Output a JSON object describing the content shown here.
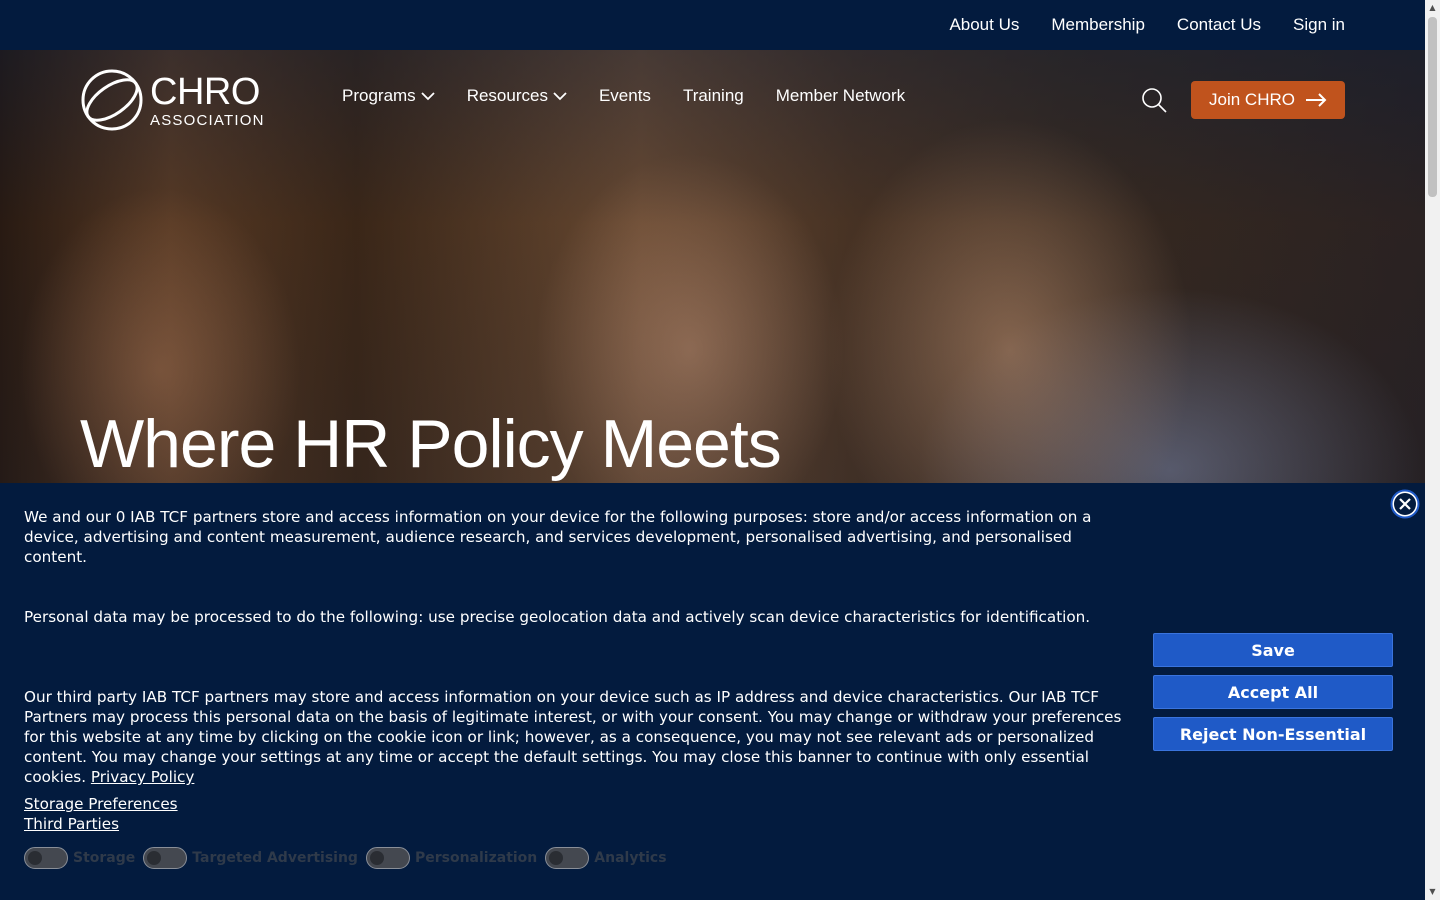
{
  "topbar": {
    "links": [
      "About Us",
      "Membership",
      "Contact Us",
      "Sign in"
    ]
  },
  "logo": {
    "line1": "CHRO",
    "line2": "ASSOCIATION"
  },
  "nav": {
    "items": [
      {
        "label": "Programs",
        "dropdown": true
      },
      {
        "label": "Resources",
        "dropdown": true
      },
      {
        "label": "Events",
        "dropdown": false
      },
      {
        "label": "Training",
        "dropdown": false
      },
      {
        "label": "Member Network",
        "dropdown": false
      }
    ],
    "join_label": "Join CHRO",
    "search_icon": "search-icon"
  },
  "hero": {
    "title": "Where HR Policy Meets"
  },
  "cookie_banner": {
    "p1": "We and our 0 IAB TCF partners store and access information on your device for the following purposes: store and/or access information on a device, advertising and content measurement, audience research, and services development, personalised advertising, and personalised content.",
    "p2": "Personal data may be processed to do the following: use precise geolocation data and actively scan device characteristics for identification.",
    "p3": "Our third party IAB TCF partners may store and access information on your device such as IP address and device characteristics. Our IAB TCF Partners may process this personal data on the basis of legitimate interest, or with your consent. You may change or withdraw your preferences for this website at any time by clicking on the cookie icon or link; however, as a consequence, you may not see relevant ads or personalized content. You may change your settings at any time or accept the default settings. You may close this banner to continue with only essential cookies.",
    "privacy_link": "Privacy Policy",
    "storage_pref_link": "Storage Preferences",
    "third_parties_link": "Third Parties",
    "toggles": [
      "Storage",
      "Targeted Advertising",
      "Personalization",
      "Analytics"
    ],
    "buttons": {
      "save": "Save",
      "accept_all": "Accept All",
      "reject": "Reject Non-Essential"
    }
  },
  "colors": {
    "navy": "#031b3e",
    "join_orange": "#c0531d",
    "cookie_button_blue": "#1f5ac7"
  }
}
